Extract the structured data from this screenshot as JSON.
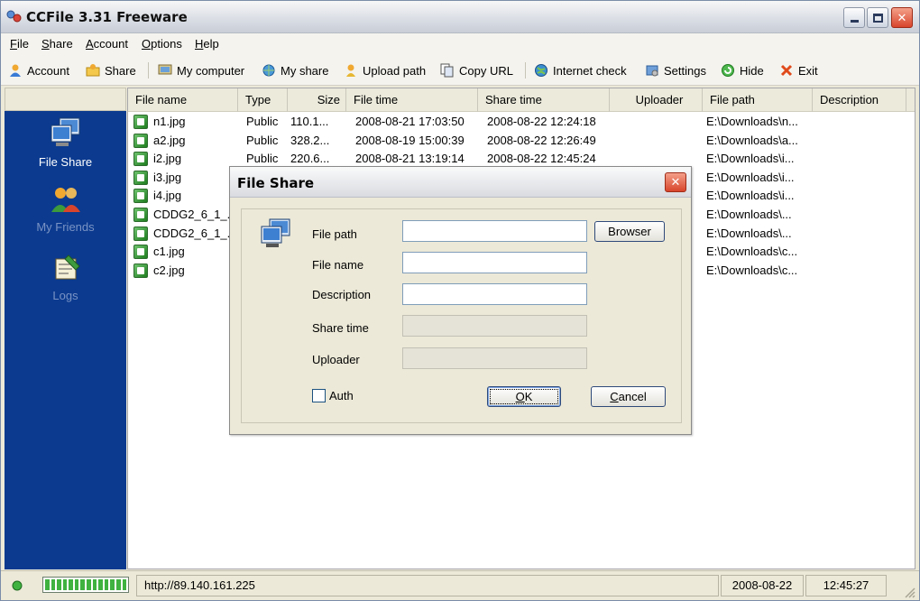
{
  "window": {
    "title": "CCFile 3.31 Freeware"
  },
  "menu": [
    {
      "label": "File",
      "accel": "F",
      "rest": "ile"
    },
    {
      "label": "Share",
      "accel": "S",
      "rest": "hare"
    },
    {
      "label": "Account",
      "accel": "A",
      "rest": "ccount"
    },
    {
      "label": "Options",
      "accel": "O",
      "rest": "ptions"
    },
    {
      "label": "Help",
      "accel": "H",
      "rest": "elp"
    }
  ],
  "toolbar": {
    "account": "Account",
    "share": "Share",
    "my_computer": "My computer",
    "my_share": "My share",
    "upload_path": "Upload path",
    "copy_url": "Copy URL",
    "internet_check": "Internet check",
    "settings": "Settings",
    "hide": "Hide",
    "exit": "Exit"
  },
  "sidebar": {
    "items": [
      {
        "label": "File Share",
        "active": true
      },
      {
        "label": "My Friends",
        "active": false
      },
      {
        "label": "Logs",
        "active": false
      }
    ]
  },
  "list": {
    "columns": [
      "File name",
      "Type",
      "Size",
      "File time",
      "Share time",
      "Uploader",
      "File path",
      "Description"
    ],
    "rows": [
      {
        "name": "n1.jpg",
        "type": "Public",
        "size": "110.1...",
        "file_time": "2008-08-21 17:03:50",
        "share_time": "2008-08-22 12:24:18",
        "uploader": "",
        "path": "E:\\Downloads\\n...",
        "description": ""
      },
      {
        "name": "a2.jpg",
        "type": "Public",
        "size": "328.2...",
        "file_time": "2008-08-19 15:00:39",
        "share_time": "2008-08-22 12:26:49",
        "uploader": "",
        "path": "E:\\Downloads\\a...",
        "description": ""
      },
      {
        "name": "i2.jpg",
        "type": "Public",
        "size": "220.6...",
        "file_time": "2008-08-21 13:19:14",
        "share_time": "2008-08-22 12:45:24",
        "uploader": "",
        "path": "E:\\Downloads\\i...",
        "description": ""
      },
      {
        "name": "i3.jpg",
        "type": "",
        "size": "",
        "file_time": "",
        "share_time": "",
        "uploader": "",
        "path": "E:\\Downloads\\i...",
        "description": ""
      },
      {
        "name": "i4.jpg",
        "type": "",
        "size": "",
        "file_time": "",
        "share_time": "",
        "uploader": "",
        "path": "E:\\Downloads\\i...",
        "description": ""
      },
      {
        "name": "CDDG2_6_1_...",
        "type": "",
        "size": "",
        "file_time": "",
        "share_time": "",
        "uploader": "",
        "path": "E:\\Downloads\\...",
        "description": ""
      },
      {
        "name": "CDDG2_6_1_...",
        "type": "",
        "size": "",
        "file_time": "",
        "share_time": "",
        "uploader": "",
        "path": "E:\\Downloads\\...",
        "description": ""
      },
      {
        "name": "c1.jpg",
        "type": "",
        "size": "",
        "file_time": "",
        "share_time": "",
        "uploader": "",
        "path": "E:\\Downloads\\c...",
        "description": ""
      },
      {
        "name": "c2.jpg",
        "type": "",
        "size": "",
        "file_time": "",
        "share_time": "",
        "uploader": "",
        "path": "E:\\Downloads\\c...",
        "description": ""
      }
    ]
  },
  "dialog": {
    "title": "File Share",
    "file_path_label": "File path",
    "file_name_label": "File name",
    "description_label": "Description",
    "share_time_label": "Share time",
    "uploader_label": "Uploader",
    "file_path_value": "",
    "file_name_value": "",
    "description_value": "",
    "share_time_value": "",
    "uploader_value": "",
    "browser_label": "Browser",
    "auth_label": "Auth",
    "auth_checked": false,
    "ok_label": "OK",
    "ok_accel": "O",
    "ok_rest": "K",
    "cancel_label": "Cancel",
    "cancel_accel": "C",
    "cancel_rest": "ancel"
  },
  "status": {
    "progress_percent": 100,
    "url": "http://89.140.161.225",
    "date": "2008-08-22",
    "time": "12:45:27"
  },
  "colors": {
    "sidebar_bg": "#0b3a8f",
    "sidebar_active_text": "#ffffff",
    "sidebar_inactive_text": "#7a93c4",
    "progress": "#3fb23f"
  }
}
